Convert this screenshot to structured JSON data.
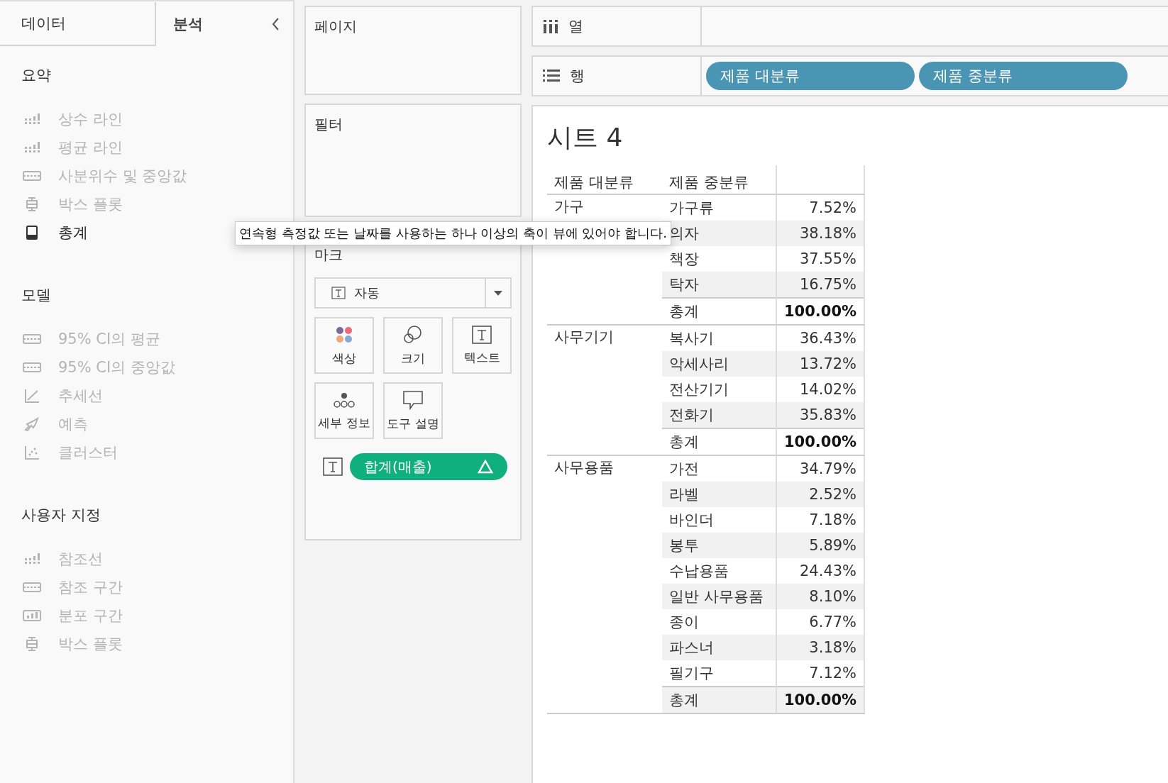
{
  "side_tabs": [
    {
      "label": "데이터",
      "selected": false
    },
    {
      "label": "분석",
      "selected": true
    }
  ],
  "sections": [
    {
      "title": "요약",
      "items": [
        {
          "label": "상수 라인",
          "kind": "bars",
          "disabled": true
        },
        {
          "label": "평균 라인",
          "kind": "bars",
          "disabled": true
        },
        {
          "label": "사분위수 및 중앙값",
          "kind": "band",
          "disabled": true
        },
        {
          "label": "박스 플롯",
          "kind": "box",
          "disabled": true
        },
        {
          "label": "총계",
          "kind": "total",
          "disabled": false
        }
      ]
    },
    {
      "title": "모델",
      "items": [
        {
          "label": "95% CI의 평균",
          "kind": "band",
          "disabled": true
        },
        {
          "label": "95% CI의 중앙값",
          "kind": "band",
          "disabled": true
        },
        {
          "label": "추세선",
          "kind": "trend",
          "disabled": true
        },
        {
          "label": "예측",
          "kind": "forecast",
          "disabled": true
        },
        {
          "label": "클러스터",
          "kind": "cluster",
          "disabled": true
        }
      ]
    },
    {
      "title": "사용자 지정",
      "items": [
        {
          "label": "참조선",
          "kind": "bars",
          "disabled": true
        },
        {
          "label": "참조 구간",
          "kind": "band",
          "disabled": true
        },
        {
          "label": "분포 구간",
          "kind": "dist",
          "disabled": true
        },
        {
          "label": "박스 플롯",
          "kind": "box",
          "disabled": true
        }
      ]
    }
  ],
  "pages_card": {
    "title": "페이지"
  },
  "filters_card": {
    "title": "필터"
  },
  "marks_card": {
    "title": "마크",
    "mark_type": "자동",
    "buttons": [
      {
        "label": "색상",
        "kind": "color"
      },
      {
        "label": "크기",
        "kind": "size"
      },
      {
        "label": "텍스트",
        "kind": "text"
      },
      {
        "label": "세부 정보",
        "kind": "detail"
      },
      {
        "label": "도구 설명",
        "kind": "tooltip"
      }
    ],
    "pill": {
      "label": "합계(매출)"
    }
  },
  "tooltip": "연속형 측정값 또는 날짜를 사용하는 하나 이상의 축이 뷰에 있어야 합니다.",
  "columns_shelf": {
    "label": "열"
  },
  "rows_shelf": {
    "label": "행",
    "pills": [
      "제품 대분류",
      "제품 중분류"
    ]
  },
  "sheet": {
    "title": "시트 4",
    "headers": [
      "제품 대분류",
      "제품 중분류"
    ],
    "groups": [
      {
        "name": "가구",
        "rows": [
          {
            "sub": "가구류",
            "value": "7.52%",
            "kind": "item"
          },
          {
            "sub": "의자",
            "value": "38.18%",
            "kind": "item"
          },
          {
            "sub": "책장",
            "value": "37.55%",
            "kind": "item"
          },
          {
            "sub": "탁자",
            "value": "16.75%",
            "kind": "item"
          },
          {
            "sub": "총계",
            "value": "100.00%",
            "kind": "total"
          }
        ]
      },
      {
        "name": "사무기기",
        "rows": [
          {
            "sub": "복사기",
            "value": "36.43%",
            "kind": "item"
          },
          {
            "sub": "악세사리",
            "value": "13.72%",
            "kind": "item"
          },
          {
            "sub": "전산기기",
            "value": "14.02%",
            "kind": "item"
          },
          {
            "sub": "전화기",
            "value": "35.83%",
            "kind": "item"
          },
          {
            "sub": "총계",
            "value": "100.00%",
            "kind": "total"
          }
        ]
      },
      {
        "name": "사무용품",
        "rows": [
          {
            "sub": "가전",
            "value": "34.79%",
            "kind": "item"
          },
          {
            "sub": "라벨",
            "value": "2.52%",
            "kind": "item"
          },
          {
            "sub": "바인더",
            "value": "7.18%",
            "kind": "item"
          },
          {
            "sub": "봉투",
            "value": "5.89%",
            "kind": "item"
          },
          {
            "sub": "수납용품",
            "value": "24.43%",
            "kind": "item"
          },
          {
            "sub": "일반 사무용품",
            "value": "8.10%",
            "kind": "item"
          },
          {
            "sub": "종이",
            "value": "6.77%",
            "kind": "item"
          },
          {
            "sub": "파스너",
            "value": "3.18%",
            "kind": "item"
          },
          {
            "sub": "필기구",
            "value": "7.12%",
            "kind": "item"
          },
          {
            "sub": "총계",
            "value": "100.00%",
            "kind": "total"
          }
        ]
      }
    ]
  }
}
